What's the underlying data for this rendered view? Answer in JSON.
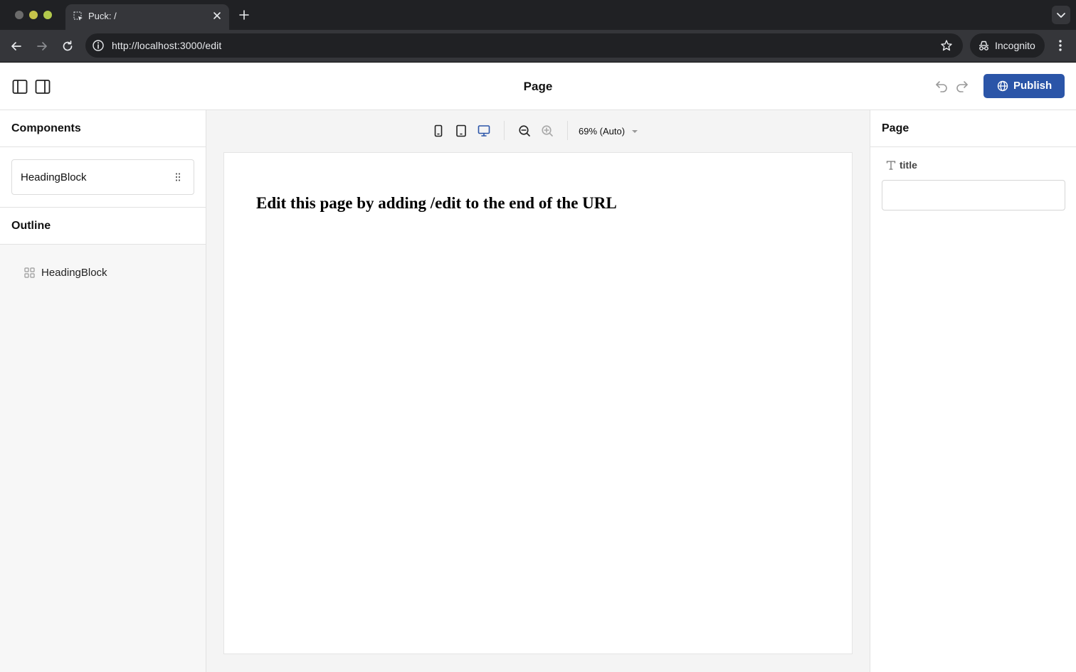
{
  "browser": {
    "tab_title": "Puck: /",
    "url": "http://localhost:3000/edit",
    "incognito_label": "Incognito",
    "icons": [
      "favicon-icon",
      "close-icon",
      "plus-icon",
      "chevron-down-icon",
      "back-arrow-icon",
      "forward-arrow-icon",
      "reload-icon",
      "info-icon",
      "star-icon",
      "incognito-icon",
      "kebab-menu-icon"
    ]
  },
  "header": {
    "title": "Page",
    "publish_label": "Publish",
    "icons": [
      "left-panel-toggle-icon",
      "right-panel-toggle-icon",
      "undo-icon",
      "redo-icon",
      "globe-icon"
    ]
  },
  "left_sidebar": {
    "components_heading": "Components",
    "components": [
      {
        "label": "HeadingBlock"
      }
    ],
    "outline_heading": "Outline",
    "outline": [
      {
        "label": "HeadingBlock"
      }
    ]
  },
  "canvas": {
    "viewports": [
      "mobile-viewport-icon",
      "tablet-viewport-icon",
      "desktop-viewport-icon"
    ],
    "zoom_label": "69% (Auto)",
    "heading_text": "Edit this page by adding /edit to the end of the URL"
  },
  "right_sidebar": {
    "heading": "Page",
    "field_label": "title",
    "field_value": ""
  },
  "colors": {
    "accent": "#2b55a8",
    "chrome_dark": "#202124",
    "chrome_toolbar": "#35363a"
  }
}
